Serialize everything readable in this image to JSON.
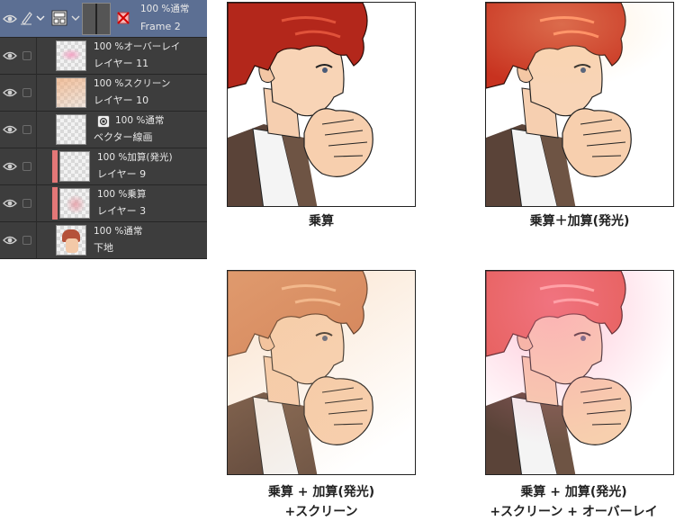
{
  "layer_panel": {
    "folder": {
      "opacity": "100 %",
      "blend": "通常",
      "name": "Frame 2"
    },
    "layers": [
      {
        "opacity": "100 %",
        "blend": "オーバーレイ",
        "name": "レイヤー 11"
      },
      {
        "opacity": "100 %",
        "blend": "スクリーン",
        "name": "レイヤー 10"
      },
      {
        "opacity": "100 %",
        "blend": "通常",
        "name": "ベクター線画"
      },
      {
        "opacity": "100 %",
        "blend": "加算(発光)",
        "name": "レイヤー 9"
      },
      {
        "opacity": "100 %",
        "blend": "乗算",
        "name": "レイヤー 3"
      },
      {
        "opacity": "100 %",
        "blend": "通常",
        "name": "下地"
      }
    ]
  },
  "comparisons": [
    {
      "caption_line1": "乗算",
      "caption_line2": ""
    },
    {
      "caption_line1": "乗算＋加算(発光)",
      "caption_line2": ""
    },
    {
      "caption_line1": "乗算 + 加算(発光)",
      "caption_line2": "+スクリーン"
    },
    {
      "caption_line1": "乗算 + 加算(発光)",
      "caption_line2": "+スクリーン + オーバーレイ"
    }
  ],
  "colors": {
    "panel_bg": "#3d3d3d",
    "selected_row": "#5c6f93",
    "clip_marker": "#e37777",
    "hair_multiply": "#b3271b",
    "hair_add": "#c8321f",
    "hair_screen": "#cf7b52",
    "hair_overlay": "#e2584f"
  }
}
